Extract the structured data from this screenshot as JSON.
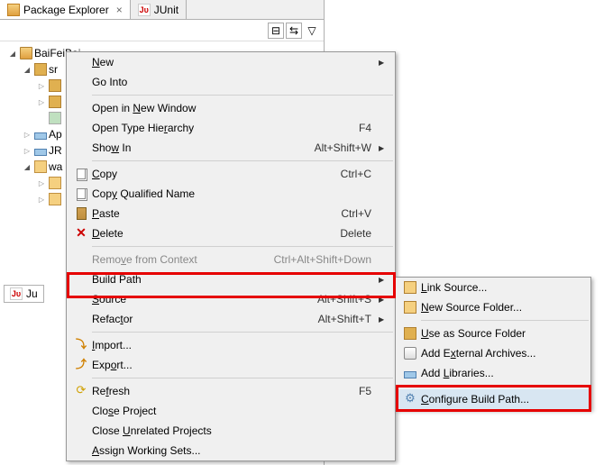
{
  "tabs": {
    "package_explorer": "Package Explorer",
    "junit": "JUnit"
  },
  "tree": {
    "project": "BaiFeiBai",
    "src": "sr",
    "apache": "Ap",
    "jre": "JR",
    "wa": "wa"
  },
  "menu": {
    "new": "New",
    "go_into": "Go Into",
    "open_new_window": "Open in New Window",
    "open_type_hierarchy": "Open Type Hierarchy",
    "open_type_hierarchy_key": "F4",
    "show_in": "Show In",
    "show_in_key": "Alt+Shift+W",
    "copy": "Copy",
    "copy_key": "Ctrl+C",
    "copy_qualified": "Copy Qualified Name",
    "paste": "Paste",
    "paste_key": "Ctrl+V",
    "delete": "Delete",
    "delete_key": "Delete",
    "remove_context": "Remove from Context",
    "remove_context_key": "Ctrl+Alt+Shift+Down",
    "build_path": "Build Path",
    "source": "Source",
    "source_key": "Alt+Shift+S",
    "refactor": "Refactor",
    "refactor_key": "Alt+Shift+T",
    "import": "Import...",
    "export": "Export...",
    "refresh": "Refresh",
    "refresh_key": "F5",
    "close_project": "Close Project",
    "close_unrelated": "Close Unrelated Projects",
    "assign_working": "Assign Working Sets..."
  },
  "submenu": {
    "link_source": "Link Source...",
    "new_source_folder": "New Source Folder...",
    "use_as_source": "Use as Source Folder",
    "add_external": "Add External Archives...",
    "add_libraries": "Add Libraries...",
    "configure": "Configure Build Path..."
  },
  "bottom_tab": "Ju"
}
